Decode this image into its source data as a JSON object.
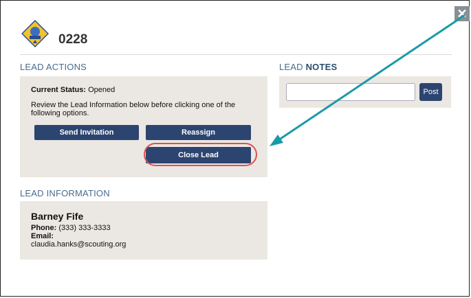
{
  "header": {
    "lead_id": "0228",
    "close_glyph": "✕",
    "badge_icon": "cub-scout-badge-icon"
  },
  "lead_actions": {
    "title": "LEAD ACTIONS",
    "status_label": "Current Status:",
    "status_value": "Opened",
    "instructions": "Review the Lead Information below before clicking one of the following options.",
    "send_label": "Send Invitation",
    "reassign_label": "Reassign",
    "close_label": "Close Lead"
  },
  "lead_notes": {
    "title_prefix": "LEAD ",
    "title_bold": "NOTES",
    "input_value": "",
    "post_label": "Post"
  },
  "lead_information": {
    "title": "LEAD INFORMATION",
    "name": "Barney Fife",
    "phone_label": "Phone:",
    "phone_value": "(333) 333-3333",
    "email_label": "Email:",
    "email_value": "claudia.hanks@scouting.org"
  },
  "colors": {
    "button": "#2c4470",
    "panel": "#ebe7e3",
    "highlight": "#d9534f",
    "annotation_arrow": "#1a9aa6"
  }
}
